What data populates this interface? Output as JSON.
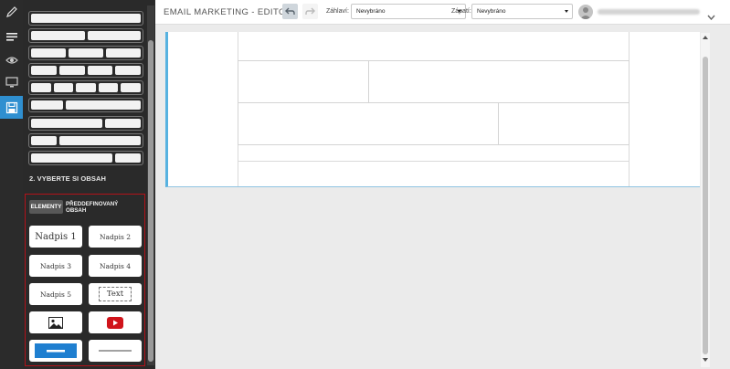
{
  "header": {
    "title": "EMAIL MARKETING - EDITOR",
    "header_label": "Záhlaví:",
    "header_value": "Nevybráno",
    "footer_label": "Zápatí:",
    "footer_value": "Nevybráno"
  },
  "rail": {
    "items": [
      {
        "icon": "pencil-icon"
      },
      {
        "icon": "lines-icon"
      },
      {
        "icon": "eye-icon"
      },
      {
        "icon": "monitor-icon"
      },
      {
        "icon": "save-icon",
        "active": true
      }
    ]
  },
  "panel": {
    "section_title": "2. VYBERTE SI OBSAH",
    "tabs": {
      "elements": "ELEMENTY",
      "predefined": "PŘEDDEFINOVANÝ OBSAH"
    },
    "tiles": {
      "h1": "Nadpis 1",
      "h2": "Nadpis 2",
      "h3": "Nadpis 3",
      "h4": "Nadpis 4",
      "h5": "Nadpis 5",
      "text": "Text",
      "image": "image-icon",
      "video": "youtube-icon",
      "button": "button-icon",
      "divider": "divider-icon"
    }
  },
  "colors": {
    "accent": "#2f8fd0",
    "canvas_border": "#57b2e0",
    "elements_box_border": "#b3121a",
    "youtube_red": "#d0141b",
    "button_blue": "#1f7fd0"
  }
}
